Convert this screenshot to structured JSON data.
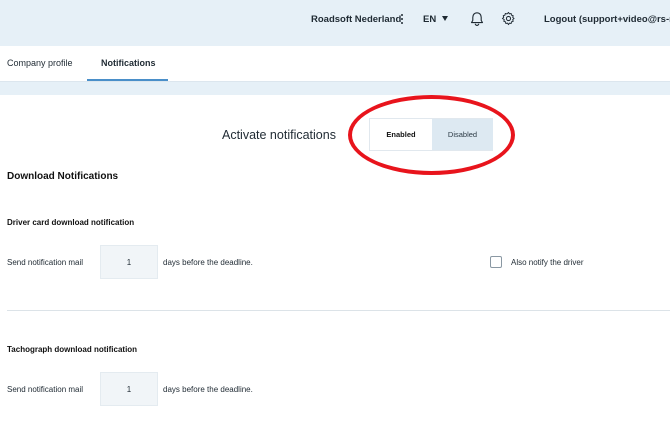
{
  "header": {
    "organization": "Roadsoft Nederland",
    "language": "EN",
    "logout_label": "Logout (support+video@rs-roa",
    "icons": [
      "kebab-menu-icon",
      "caret-down-icon",
      "bell-icon",
      "gear-icon"
    ]
  },
  "tabs": [
    {
      "label": "Company profile",
      "active": false
    },
    {
      "label": "Notifications",
      "active": true
    }
  ],
  "activate": {
    "label": "Activate notifications",
    "options": [
      "Enabled",
      "Disabled"
    ],
    "selected": "Enabled"
  },
  "download_section": {
    "title": "Download Notifications",
    "driver_card": {
      "title": "Driver card download notification",
      "send_label": "Send notification mail",
      "days_value": "1",
      "after_label": "days before the deadline.",
      "notify_driver_label": "Also notify the driver",
      "notify_driver_checked": false
    },
    "tachograph": {
      "title": "Tachograph download notification",
      "send_label": "Send notification mail",
      "days_value": "1",
      "after_label": "days before the deadline."
    }
  },
  "colors": {
    "header_bg": "#e6f0f7",
    "tab_underline": "#4a8fc9",
    "disabled_option_bg": "#dde9f2",
    "annotation_ring": "#e8141c"
  }
}
